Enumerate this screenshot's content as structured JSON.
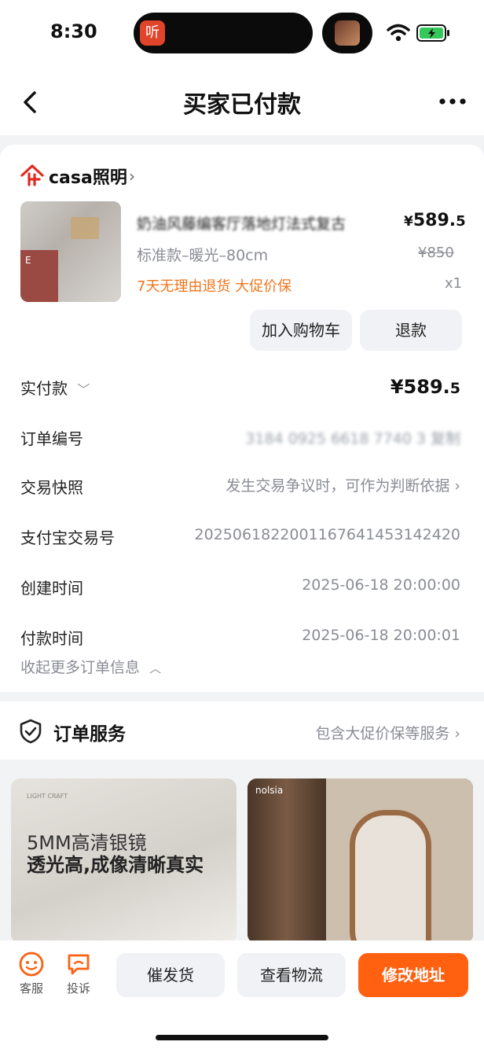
{
  "status": {
    "time": "8:30",
    "island_app": "听"
  },
  "nav": {
    "title": "买家已付款"
  },
  "shop": {
    "name": "casa照明"
  },
  "product": {
    "name": "  奶油风藤编客厅落地灯法式复古",
    "price_symbol": "¥",
    "price_int": "589.",
    "price_dec": "5",
    "spec": "标准款–暖光–80cm",
    "orig_price": "¥850",
    "tags": "7天无理由退货  大促价保",
    "qty": "x1",
    "thumb_letter": "E"
  },
  "buttons": {
    "cart": "加入购物车",
    "refund": "退款"
  },
  "details": {
    "paid_label": "实付款",
    "paid_int": "¥589.",
    "paid_dec": "5",
    "order_no_label": "订单编号",
    "order_no_value": "3184 0925 6618 7740 3 复制",
    "snapshot_label": "交易快照",
    "snapshot_value": "发生交易争议时，可作为判断依据",
    "alipay_label": "支付宝交易号",
    "alipay_value": "2025061822001167641453142420",
    "create_label": "创建时间",
    "create_value": "2025-06-18 20:00:00",
    "pay_label": "付款时间",
    "pay_value": "2025-06-18 20:00:01",
    "collapse": "收起更多订单信息"
  },
  "services": {
    "title": "订单服务",
    "desc": "包含大促价保等服务"
  },
  "recs": [
    {
      "brand": "LIGHT CRAFT",
      "line1": "5MM高清银镜",
      "line2": "透光高,成像清晰真实"
    },
    {
      "brand": "nolsia"
    }
  ],
  "bottom": {
    "service": "客服",
    "complain": "投诉",
    "urge": "催发货",
    "logistics": "查看物流",
    "change_addr": "修改地址"
  },
  "colors": {
    "accent": "#ff6111",
    "tag": "#f0751c",
    "battery": "#34c759"
  }
}
